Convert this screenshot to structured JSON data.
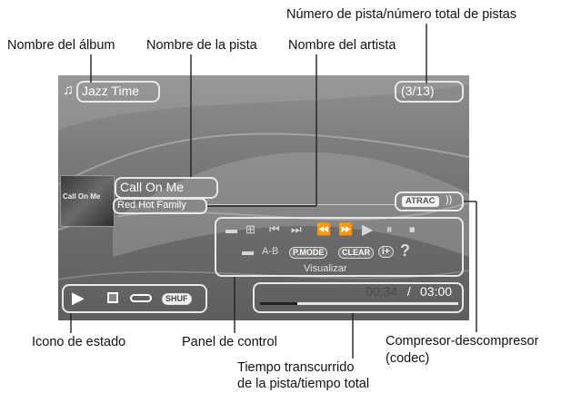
{
  "callouts": {
    "track_number": "Número de pista/número total de pistas",
    "album_name": "Nombre del álbum",
    "track_name": "Nombre de la pista",
    "artist_name": "Nombre del artista",
    "status_icon": "Icono de estado",
    "control_panel": "Panel de control",
    "codec_line1": "Compresor-descompresor",
    "codec_line2": "(codec)",
    "time_line1": "Tiempo transcurrido",
    "time_line2": "de la pista/tiempo total"
  },
  "screen": {
    "music_icon": "♫",
    "album": "Jazz Time",
    "track_counter": "(3/13)",
    "track": "Call On Me",
    "artist": "Red Hot Family",
    "album_art_text": "Call On Me",
    "codec": "ATRAC",
    "ab_label": "A-B",
    "pmode": "P.MODE",
    "clear": "CLEAR",
    "help": "?",
    "visualizer": "Visualizar",
    "shuffle": "SHUF",
    "elapsed": "00:34",
    "separator": " / ",
    "total": "03:00"
  },
  "icons": {
    "track_prev": "first-page-icon",
    "track_next": "next-page-icon",
    "skip_back": "skip-previous-icon",
    "skip_forward": "skip-next-icon",
    "rewind": "rewind-icon",
    "fast_forward": "fast-forward-icon",
    "play": "play-icon",
    "pause": "pause-icon",
    "stop": "stop-icon",
    "repeat_single": "repeat-one-icon",
    "info": "info-icon",
    "status_play": "play-status-icon",
    "folder": "folder-icon",
    "repeat": "repeat-icon"
  },
  "progress": {
    "fraction": 0.19
  }
}
